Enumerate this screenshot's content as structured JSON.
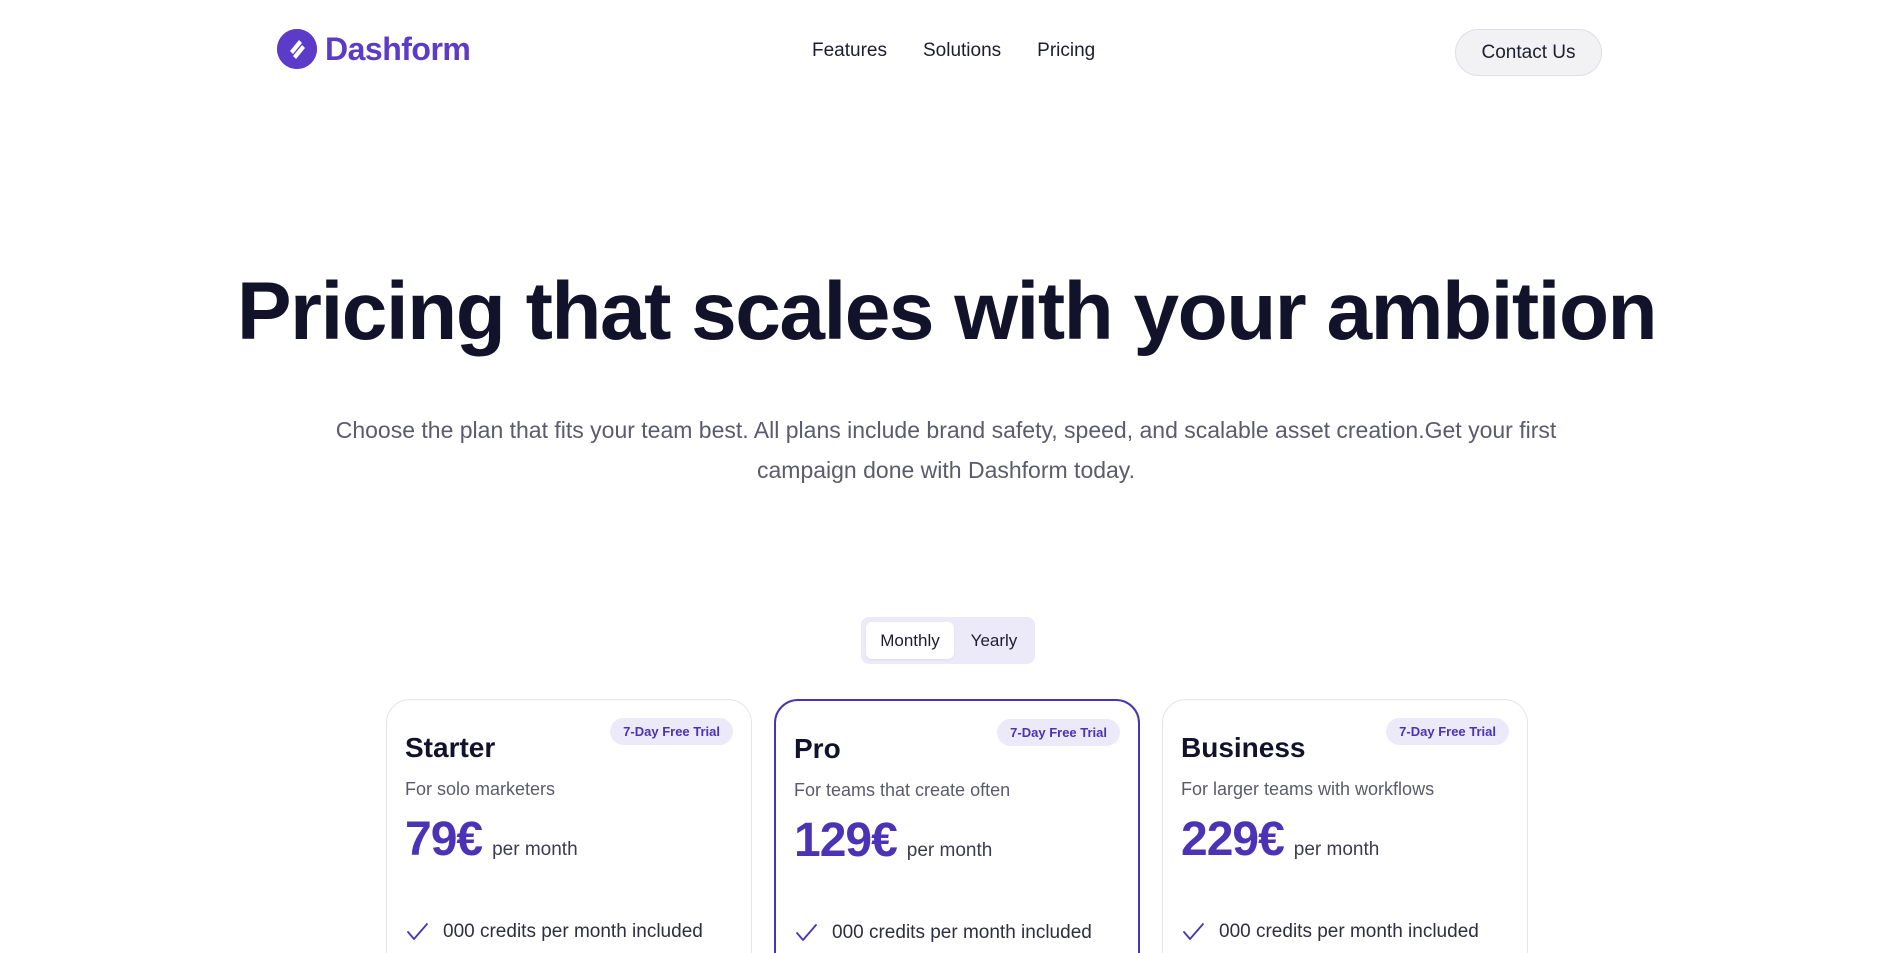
{
  "brand": {
    "name": "Dashform",
    "color": "#5b3bc8"
  },
  "nav": {
    "items": [
      {
        "label": "Features"
      },
      {
        "label": "Solutions"
      },
      {
        "label": "Pricing"
      }
    ],
    "contact_label": "Contact Us"
  },
  "hero": {
    "title": "Pricing that scales with your ambition",
    "subtitle": "Choose the plan that fits your team best. All plans include brand safety, speed, and scalable asset creation.Get your first campaign done with Dashform today."
  },
  "billing_toggle": {
    "options": [
      {
        "label": "Monthly",
        "selected": true
      },
      {
        "label": "Yearly",
        "selected": false
      }
    ]
  },
  "plans": [
    {
      "name": "Starter",
      "badge": "7-Day Free Trial",
      "description": "For solo marketers",
      "price": "79€",
      "period": "per month",
      "features": [
        "000 credits per month included"
      ]
    },
    {
      "name": "Pro",
      "badge": "7-Day Free Trial",
      "description": "For teams that create often",
      "price": "129€",
      "period": "per month",
      "featured": true,
      "features": [
        "000 credits per month included"
      ]
    },
    {
      "name": "Business",
      "badge": "7-Day Free Trial",
      "description": "For larger teams with workflows",
      "price": "229€",
      "period": "per month",
      "features": [
        "000 credits per month included"
      ]
    }
  ],
  "colors": {
    "accent": "#4b33b5",
    "badge_bg": "#ece9f8",
    "text_dark": "#12122b",
    "text_muted": "#5b5b6b"
  }
}
